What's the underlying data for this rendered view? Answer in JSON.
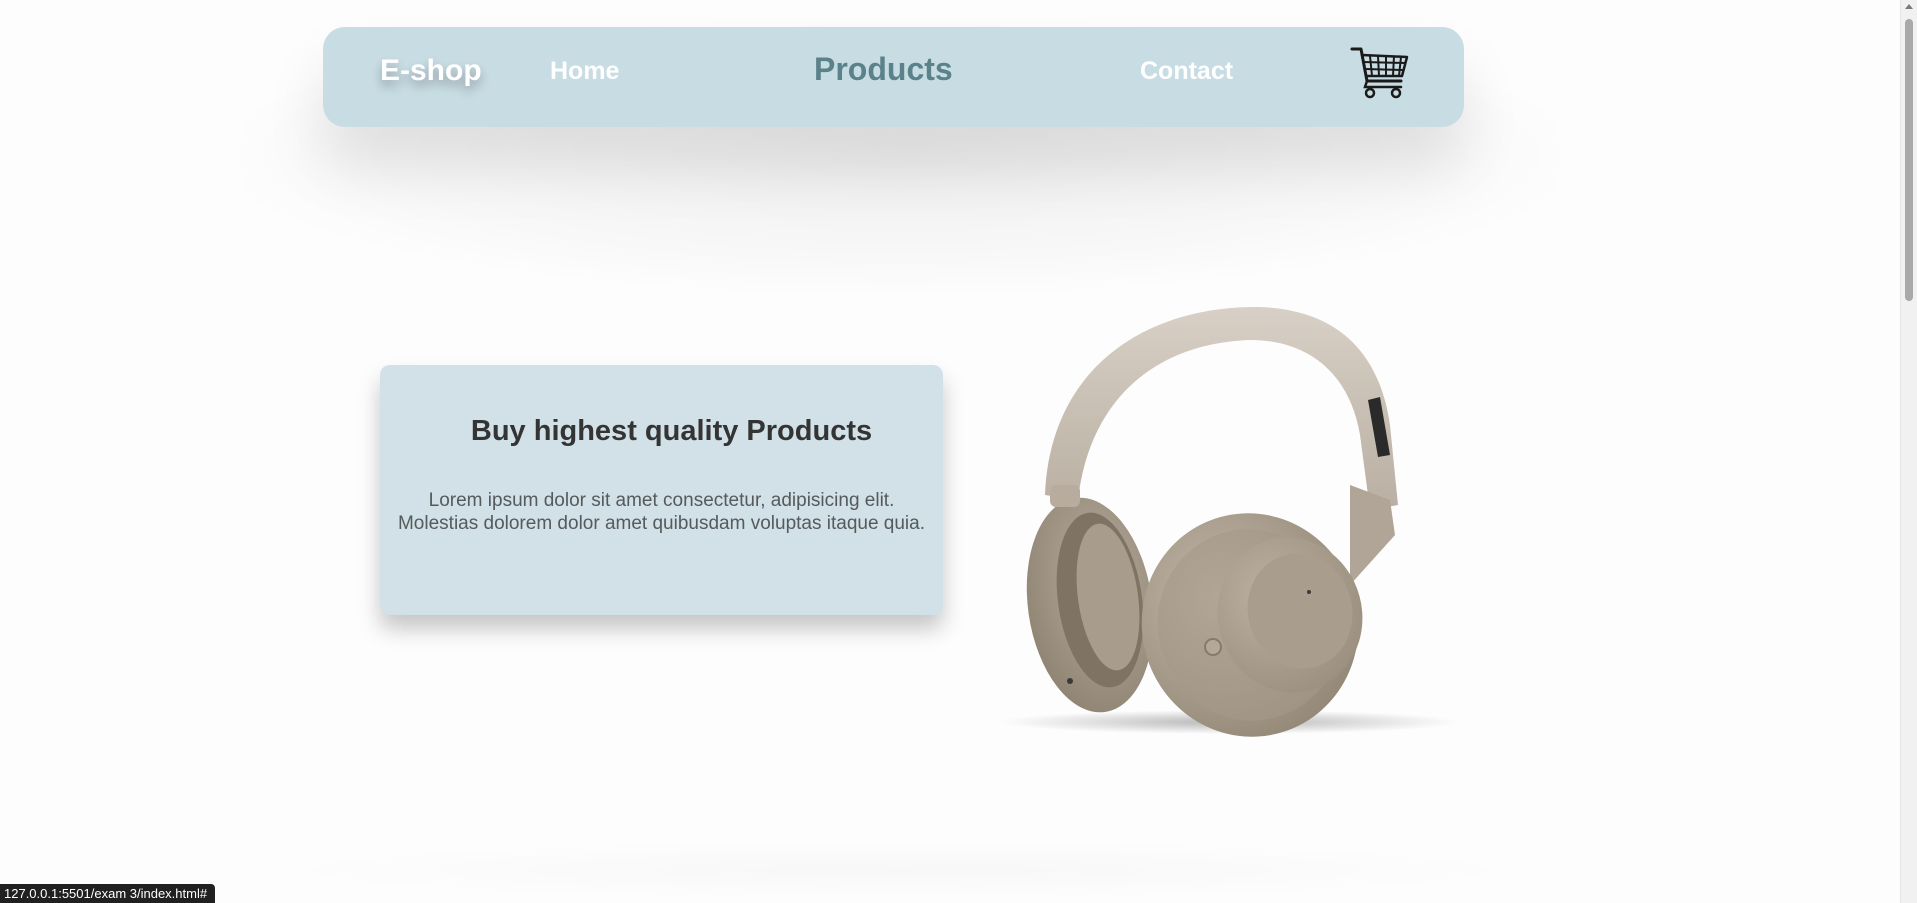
{
  "navbar": {
    "brand": "E-shop",
    "links": [
      {
        "label": "Home"
      },
      {
        "label": "Products",
        "active": true
      },
      {
        "label": "Contact"
      }
    ],
    "cart_icon": "shopping-cart-icon",
    "background_color": "#c8dce3",
    "active_link_color": "#5b828a"
  },
  "hero": {
    "title": "Buy highest quality Products",
    "text_lines": [
      "Lorem ipsum dolor sit amet consectetur, adipisicing elit.",
      "Molestias dolorem dolor amet quibusdam voluptas itaque quia."
    ],
    "card_color": "#d1e1e7",
    "image": "headphones-image"
  },
  "status_bar": {
    "url": "127.0.0.1:5501/exam 3/index.html#"
  }
}
